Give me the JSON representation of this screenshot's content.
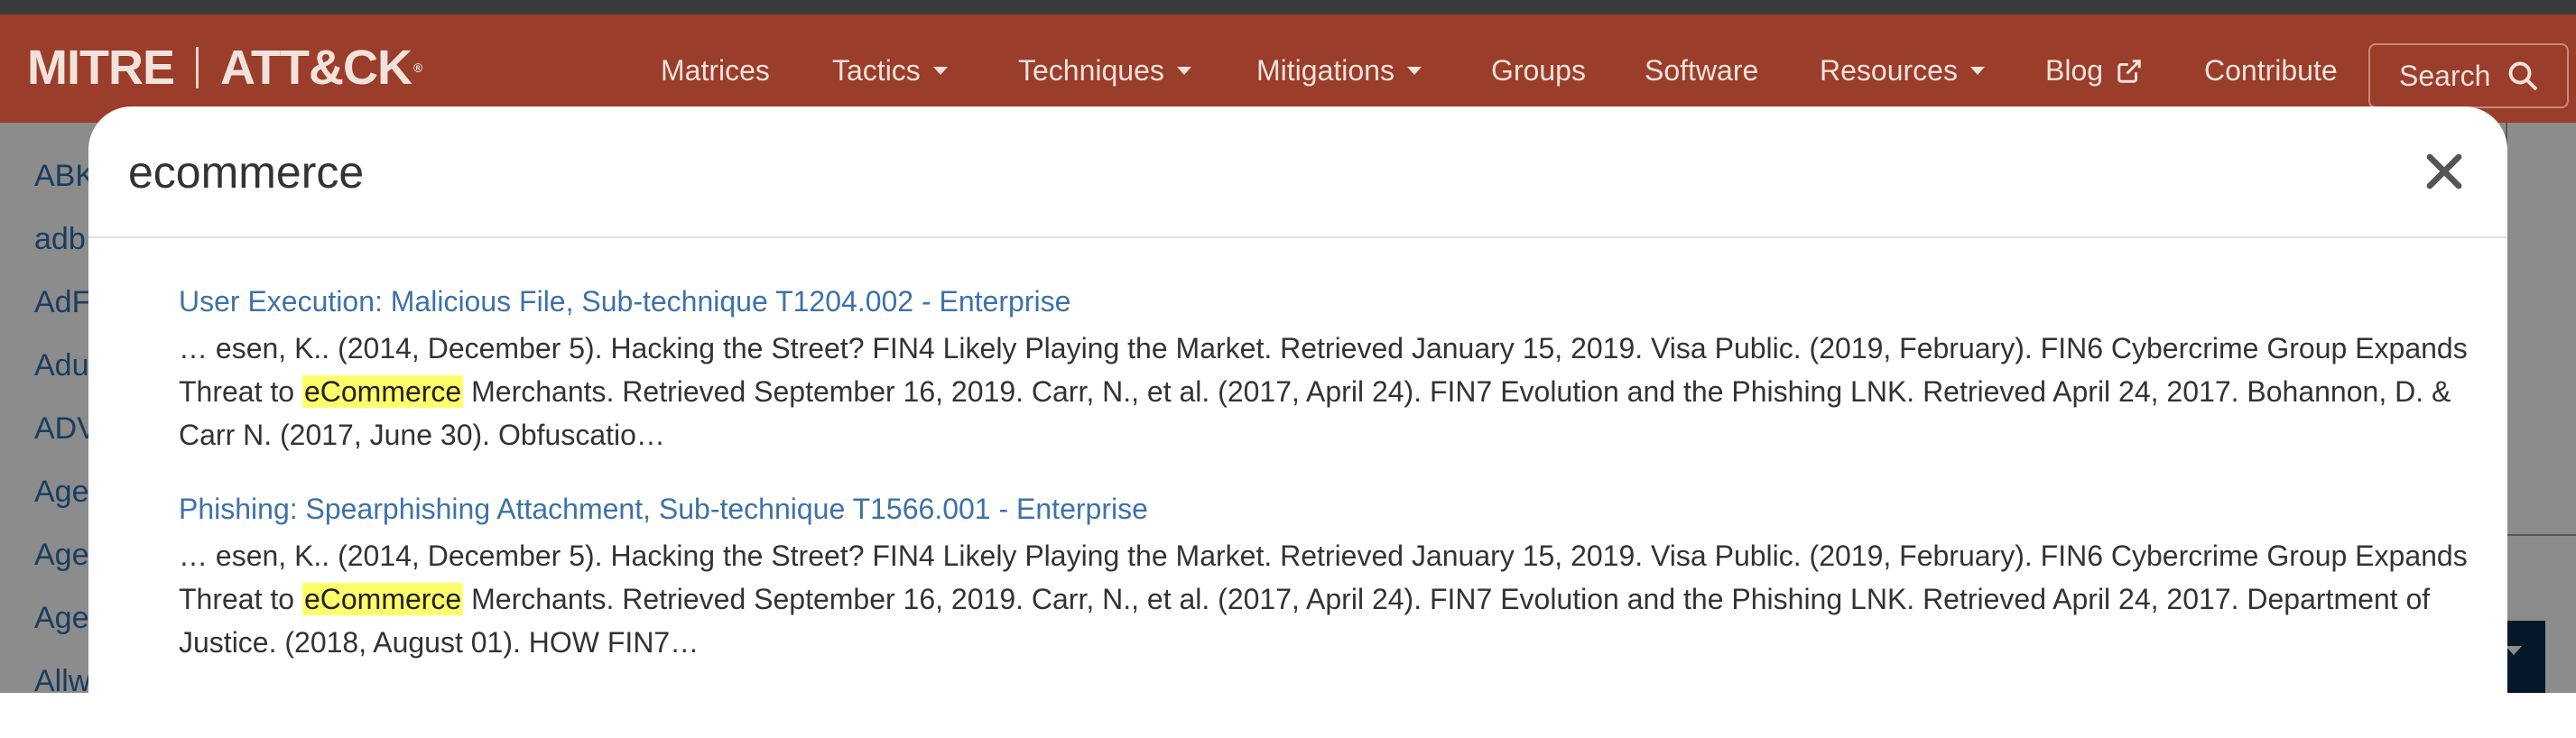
{
  "navbar": {
    "logo_left": "MITRE",
    "logo_right": "ATT&CK",
    "logo_reg": "®",
    "items": [
      "Matrices",
      "Tactics",
      "Techniques",
      "Mitigations",
      "Groups",
      "Software",
      "Resources",
      "Blog",
      "Contribute"
    ],
    "search_label": "Search"
  },
  "background_list": [
    "ABK",
    "adb",
    "AdF",
    "Adu",
    "ADV",
    "Age",
    "Age",
    "Age",
    "Allw"
  ],
  "modal": {
    "title": "ecommerce",
    "close_label": "×"
  },
  "results": [
    {
      "title": "User Execution: Malicious File, Sub-technique T1204.002 - Enterprise",
      "snippet_before": "… esen, K.. (2014, December 5). Hacking the Street? FIN4 Likely Playing the Market. Retrieved January 15, 2019. Visa Public. (2019, February). FIN6 Cybercrime Group Expands Threat to ",
      "highlight": "eCommerce",
      "snippet_after": " Merchants. Retrieved September 16, 2019. Carr, N., et al. (2017, April 24). FIN7 Evolution and the Phishing LNK. Retrieved April 24, 2017. Bohannon, D. & Carr N. (2017, June 30). Obfuscatio…"
    },
    {
      "title": "Phishing: Spearphishing Attachment, Sub-technique T1566.001 - Enterprise",
      "snippet_before": "… esen, K.. (2014, December 5). Hacking the Street? FIN4 Likely Playing the Market. Retrieved January 15, 2019. Visa Public. (2019, February). FIN6 Cybercrime Group Expands Threat to ",
      "highlight": "eCommerce",
      "snippet_after": " Merchants. Retrieved September 16, 2019. Carr, N., et al. (2017, April 24). FIN7 Evolution and the Phishing LNK. Retrieved April 24, 2017. Department of Justice. (2018, August 01). HOW FIN7…"
    }
  ],
  "colors": {
    "navbar": "#9a3d2a",
    "link": "#3d72a8",
    "highlight": "#ffff6b"
  }
}
